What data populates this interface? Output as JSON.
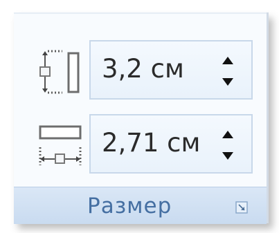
{
  "size_group": {
    "label": "Размер",
    "height_field": {
      "value": "3,2 см",
      "icon": "shape-height-icon"
    },
    "width_field": {
      "value": "2,71 см",
      "icon": "shape-width-icon"
    },
    "spin_icon": "spin-arrows-icon",
    "launcher_icon": "dialog-launcher-icon"
  }
}
